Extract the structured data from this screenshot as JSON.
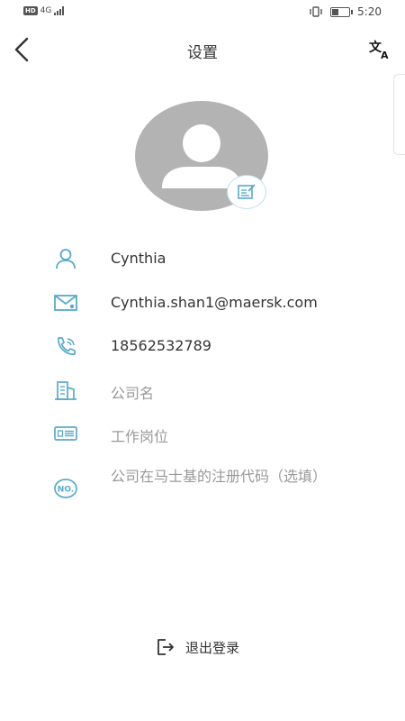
{
  "status_bar": {
    "hd_badge": "HD",
    "network": "4G",
    "time": "5:20"
  },
  "header": {
    "title": "设置"
  },
  "profile": {
    "name": "Cynthia",
    "email": "Cynthia.shan1@maersk.com",
    "phone": "18562532789",
    "company_placeholder": "公司名",
    "position_placeholder": "工作岗位",
    "registration_placeholder": "公司在马士基的注册代码（选填）"
  },
  "logout": {
    "label": "退出登录"
  },
  "colors": {
    "accent": "#58aacc",
    "avatar_bg": "#b3b3b3"
  },
  "icons": {
    "back": "chevron-left-icon",
    "translate": "translate-icon",
    "name": "user-icon",
    "email": "mail-icon",
    "phone": "phone-icon",
    "company": "building-icon",
    "position": "id-card-icon",
    "registration": "no-badge-icon",
    "logout": "exit-icon"
  }
}
